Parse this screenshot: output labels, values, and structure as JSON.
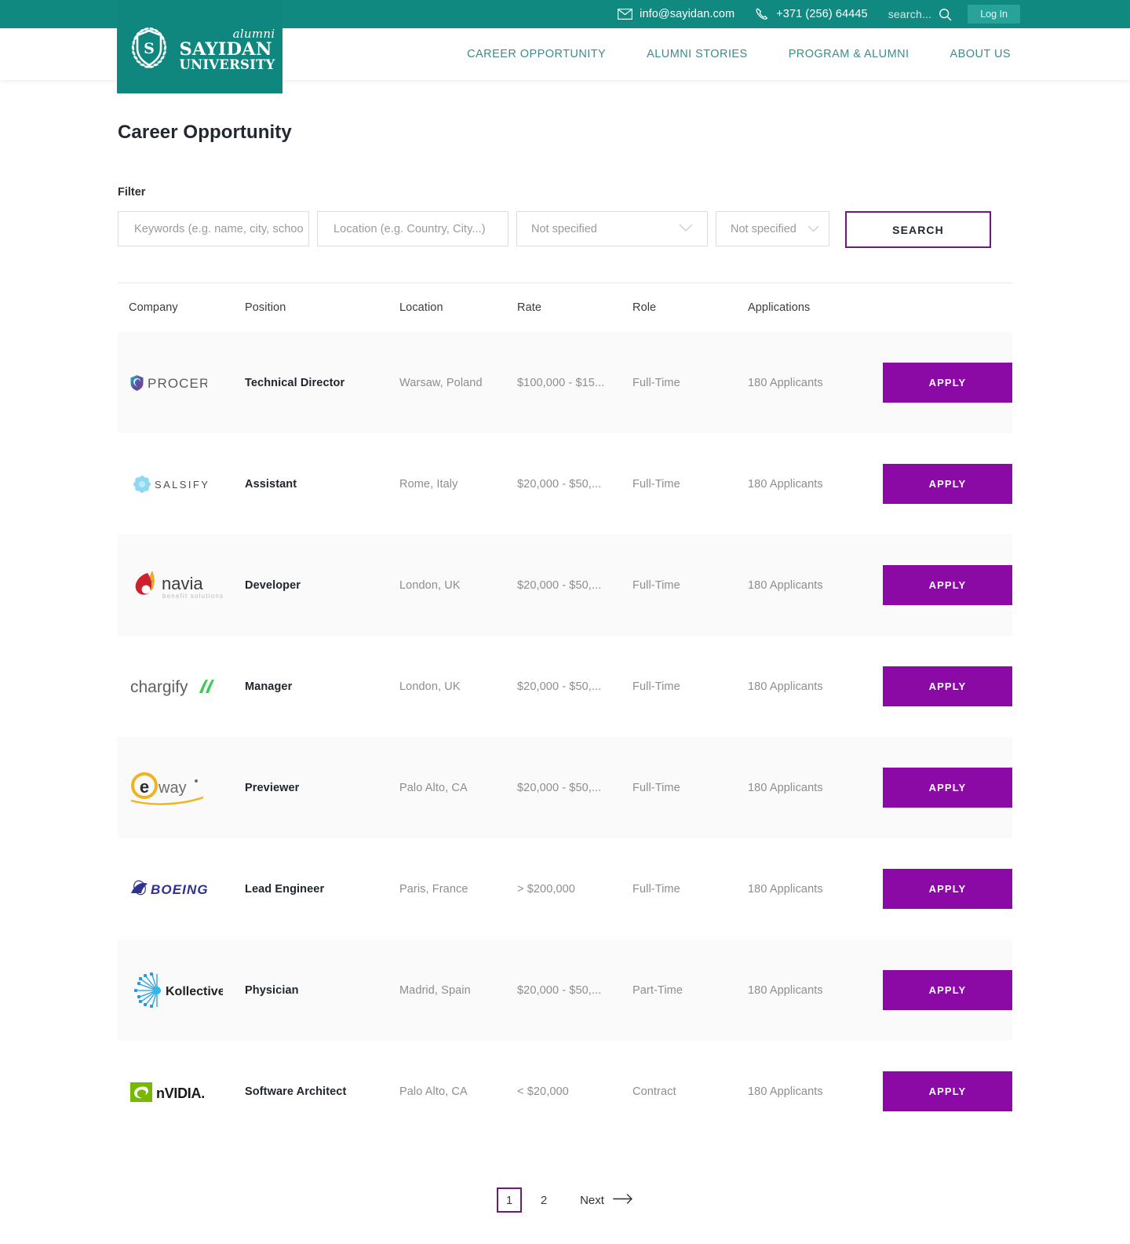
{
  "topbar": {
    "email": "info@sayidan.com",
    "phone": "+371 (256) 64445",
    "search_placeholder": "search...",
    "login_label": "Log In",
    "email_icon": "envelope-icon",
    "phone_icon": "phone-icon",
    "search_icon": "search-icon"
  },
  "logo": {
    "alumni": "alumni",
    "name": "SAYIDAN",
    "sub": "UNIVERSITY",
    "crest_letter": "S"
  },
  "nav": {
    "items": [
      {
        "label": "CAREER OPPORTUNITY"
      },
      {
        "label": "ALUMNI STORIES"
      },
      {
        "label": "PROGRAM & ALUMNI"
      },
      {
        "label": "ABOUT US"
      }
    ]
  },
  "page": {
    "title": "Career Opportunity"
  },
  "filter": {
    "label": "Filter",
    "keywords_placeholder": "Keywords (e.g. name, city, schoo",
    "location_placeholder": "Location (e.g. Country, City...)",
    "rate_value": "Not specified",
    "role_value": "Not specified",
    "search_label": "SEARCH"
  },
  "table": {
    "headers": {
      "company": "Company",
      "position": "Position",
      "location": "Location",
      "rate": "Rate",
      "role": "Role",
      "applications": "Applications"
    },
    "apply_label": "APPLY",
    "rows": [
      {
        "company": "PROCERA",
        "logo": "procera-logo",
        "position": "Technical Director",
        "location": "Warsaw, Poland",
        "rate": "$100,000 - $15...",
        "role": "Full-Time",
        "applications": "180 Applicants"
      },
      {
        "company": "SALSIFY",
        "logo": "salsify-logo",
        "position": "Assistant",
        "location": "Rome, Italy",
        "rate": "$20,000 - $50,...",
        "role": "Full-Time",
        "applications": "180 Applicants"
      },
      {
        "company": "navia benefit solutions",
        "logo": "navia-logo",
        "position": "Developer",
        "location": "London, UK",
        "rate": "$20,000 - $50,...",
        "role": "Full-Time",
        "applications": "180 Applicants"
      },
      {
        "company": "chargify",
        "logo": "chargify-logo",
        "position": "Manager",
        "location": "London, UK",
        "rate": "$20,000 - $50,...",
        "role": "Full-Time",
        "applications": "180 Applicants"
      },
      {
        "company": "eway",
        "logo": "eway-logo",
        "position": "Previewer",
        "location": "Palo Alto, CA",
        "rate": "$20,000 - $50,...",
        "role": "Full-Time",
        "applications": "180 Applicants"
      },
      {
        "company": "BOEING",
        "logo": "boeing-logo",
        "position": "Lead Engineer",
        "location": "Paris, France",
        "rate": "> $200,000",
        "role": "Full-Time",
        "applications": "180 Applicants"
      },
      {
        "company": "Kollective",
        "logo": "kollective-logo",
        "position": "Physician",
        "location": "Madrid, Spain",
        "rate": "$20,000 - $50,...",
        "role": "Part-Time",
        "applications": "180 Applicants"
      },
      {
        "company": "NVIDIA",
        "logo": "nvidia-logo",
        "position": "Software Architect",
        "location": "Palo Alto, CA",
        "rate": "< $20,000",
        "role": "Contract",
        "applications": "180 Applicants"
      }
    ]
  },
  "pagination": {
    "pages": [
      "1",
      "2"
    ],
    "active": "1",
    "next_label": "Next",
    "next_icon": "arrow-right-icon"
  },
  "colors": {
    "brand_teal": "#108a80",
    "nav_teal": "#3f8a8a",
    "accent_purple": "#8b0aa5",
    "outline_purple": "#6b1b7b"
  }
}
